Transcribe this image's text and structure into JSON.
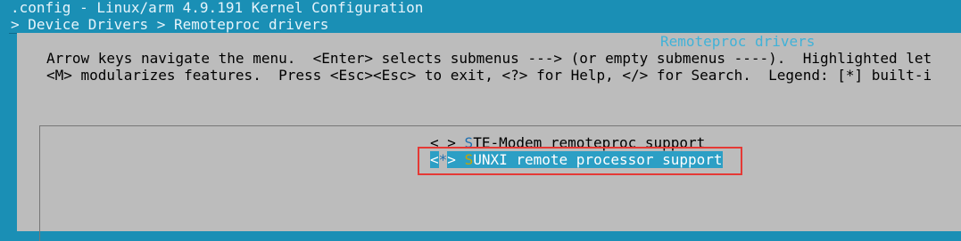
{
  "window": {
    "title": ".config - Linux/arm 4.9.191 Kernel Configuration",
    "breadcrumb": "> Device Drivers > Remoteproc drivers"
  },
  "dialog": {
    "title": "Remoteproc drivers",
    "help_line_1": "Arrow keys navigate the menu.  <Enter> selects submenus ---> (or empty submenus ----).  Highlighted let",
    "help_line_2": "<M> modularizes features.  Press <Esc><Esc> to exit, <?> for Help, </> for Search.  Legend: [*] built-i"
  },
  "menu": {
    "items": [
      {
        "state": "< >",
        "hotkey": "S",
        "label_rest": "TE-Modem remoteproc support"
      },
      {
        "state_open": "<",
        "state_mark": "*",
        "state_close": ">",
        "hotkey": "S",
        "label_rest": "UNXI remote processor support"
      }
    ]
  },
  "colors": {
    "background": "#1a8fb5",
    "dialog": "#bcbcbc",
    "selection": "#2c9fc5",
    "hotkey": "#c8a400",
    "highlight_box": "#e53935"
  }
}
